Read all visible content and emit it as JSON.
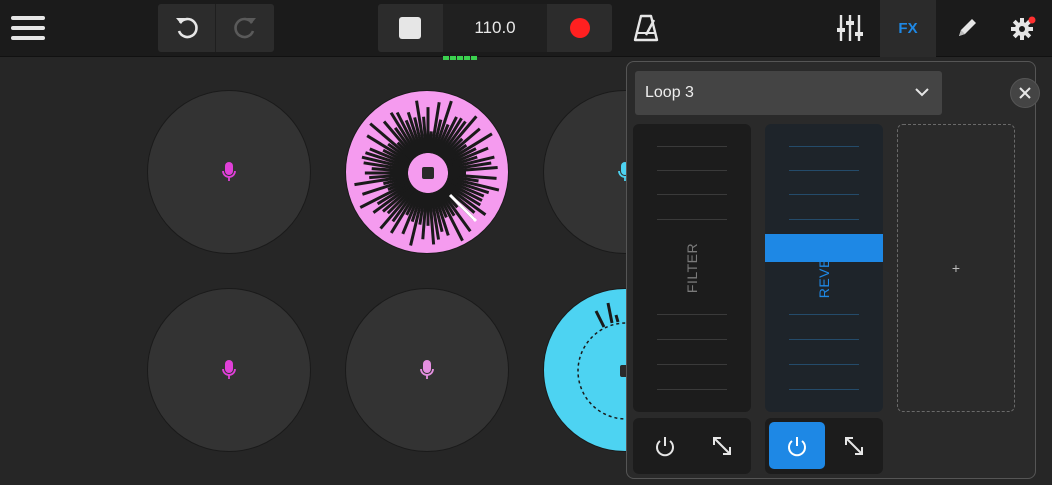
{
  "toolbar": {
    "bpm_value": "110.0",
    "fx_label": "FX"
  },
  "icons": {
    "menu": "hamburger-menu-icon",
    "undo": "undo-icon",
    "redo": "redo-icon",
    "stop": "stop-icon",
    "record": "record-icon",
    "metronome": "metronome-icon",
    "mixer": "mixer-sliders-icon",
    "edit": "pencil-icon",
    "settings": "gear-icon"
  },
  "colors": {
    "accent": "#1e88e5",
    "record": "#ff2020",
    "pink_pad": "#f59bef",
    "cyan_pad": "#4dd3f2",
    "mic_magenta": "#e040d8",
    "mic_pink": "#e48fe0",
    "bpm_meter": "#3bd14f"
  },
  "fx_panel": {
    "loop_selected": "Loop 3",
    "slots": [
      {
        "label": "FILTER",
        "power_on": false
      },
      {
        "label": "REVERB",
        "power_on": true,
        "level": 0.57
      }
    ],
    "add_slot_label": "+"
  }
}
